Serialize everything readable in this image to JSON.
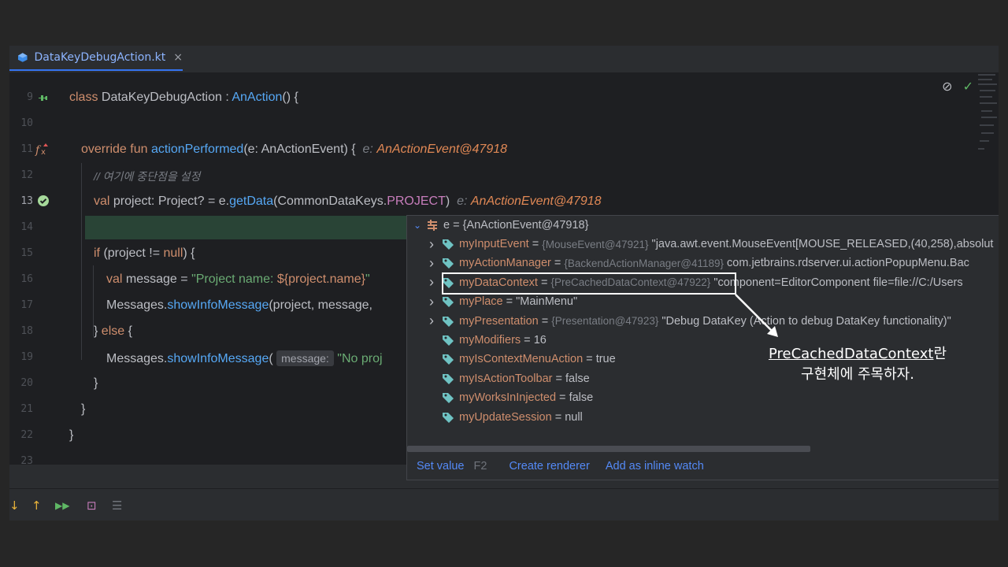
{
  "tab": {
    "label": "DataKeyDebugAction.kt",
    "close": "×"
  },
  "gutter": [
    "9",
    "10",
    "11",
    "12",
    "13",
    "14",
    "15",
    "16",
    "17",
    "18",
    "19",
    "20",
    "21",
    "22",
    "23"
  ],
  "code": {
    "l9_kw": "class ",
    "l9_name": "DataKeyDebugAction",
    "l9_sep": " : ",
    "l9_parent": "AnAction",
    "l9_end": "() {",
    "l11_kw": "override fun ",
    "l11_fn": "actionPerformed",
    "l11_args": "(e: AnActionEvent) {",
    "l11_hint_lbl": "e:",
    "l11_hint": "AnActionEvent@47918",
    "l12_comment": "// 여기에 중단점을 설정",
    "l13_kw": "val ",
    "l13_a": "project: Project? = e.",
    "l13_fn": "getData",
    "l13_b": "(CommonDataKeys.",
    "l13_const": "PROJECT",
    "l13_c": ")",
    "l13_hint_lbl": "e:",
    "l13_hint": "AnActionEvent@47918",
    "l15_kw": "if ",
    "l15_a": "(project != ",
    "l15_kw2": "null",
    "l15_b": ") {",
    "l16_kw": "val ",
    "l16_a": "message = ",
    "l16_str": "\"Project name: ",
    "l16_tpl": "${project.name}",
    "l16_str2": "\"",
    "l17_a": "Messages.",
    "l17_fn": "showInfoMessage",
    "l17_b": "(project, message,",
    "l18_a": "} ",
    "l18_kw": "else",
    "l18_b": " {",
    "l19_a": "Messages.",
    "l19_fn": "showInfoMessage",
    "l19_b": "(",
    "l19_inlay": "message:",
    "l19_str": "\"No proj",
    "l20": "}",
    "l21": "}",
    "l22": "}"
  },
  "debugger": {
    "root": "e = {AnActionEvent@47918}",
    "rows": [
      {
        "name": "myInputEvent",
        "eq": " = ",
        "type": "{MouseEvent@47921}",
        "value": " \"java.awt.event.MouseEvent[MOUSE_RELEASED,(40,258),absolut",
        "expandable": true
      },
      {
        "name": "myActionManager",
        "eq": " = ",
        "type": "{BackendActionManager@41189}",
        "value": " com.jetbrains.rdserver.ui.actionPopupMenu.Bac",
        "expandable": true
      },
      {
        "name": "myDataContext",
        "eq": " = ",
        "type": "{PreCachedDataContext@47922}",
        "value": " \"component=EditorComponent file=file://C:/Users",
        "expandable": true
      },
      {
        "name": "myPlace",
        "eq": " = ",
        "type": "",
        "value": "\"MainMenu\"",
        "expandable": true
      },
      {
        "name": "myPresentation",
        "eq": " = ",
        "type": "{Presentation@47923}",
        "value": " \"Debug DataKey (Action to debug DataKey functionality)\"",
        "expandable": true
      },
      {
        "name": "myModifiers",
        "eq": " = ",
        "type": "",
        "value": "16",
        "expandable": false
      },
      {
        "name": "myIsContextMenuAction",
        "eq": " = ",
        "type": "",
        "value": "true",
        "expandable": false
      },
      {
        "name": "myIsActionToolbar",
        "eq": " = ",
        "type": "",
        "value": "false",
        "expandable": false
      },
      {
        "name": "myWorksInInjected",
        "eq": " = ",
        "type": "",
        "value": "false",
        "expandable": false
      },
      {
        "name": "myUpdateSession",
        "eq": " = ",
        "type": "",
        "value": "null",
        "expandable": false
      }
    ],
    "footer": {
      "set_value": "Set value",
      "set_value_key": "F2",
      "create_renderer": "Create renderer",
      "add_inline_watch": "Add as inline watch"
    }
  },
  "annotation": {
    "highlight": "PreCachedDataContext",
    "suffix": "란",
    "line2": "구현체에 주목하자."
  },
  "colors": {
    "accent": "#3574f0",
    "exec_line": "#294436",
    "keyword": "#cf8e6d",
    "function": "#56a8f5"
  }
}
